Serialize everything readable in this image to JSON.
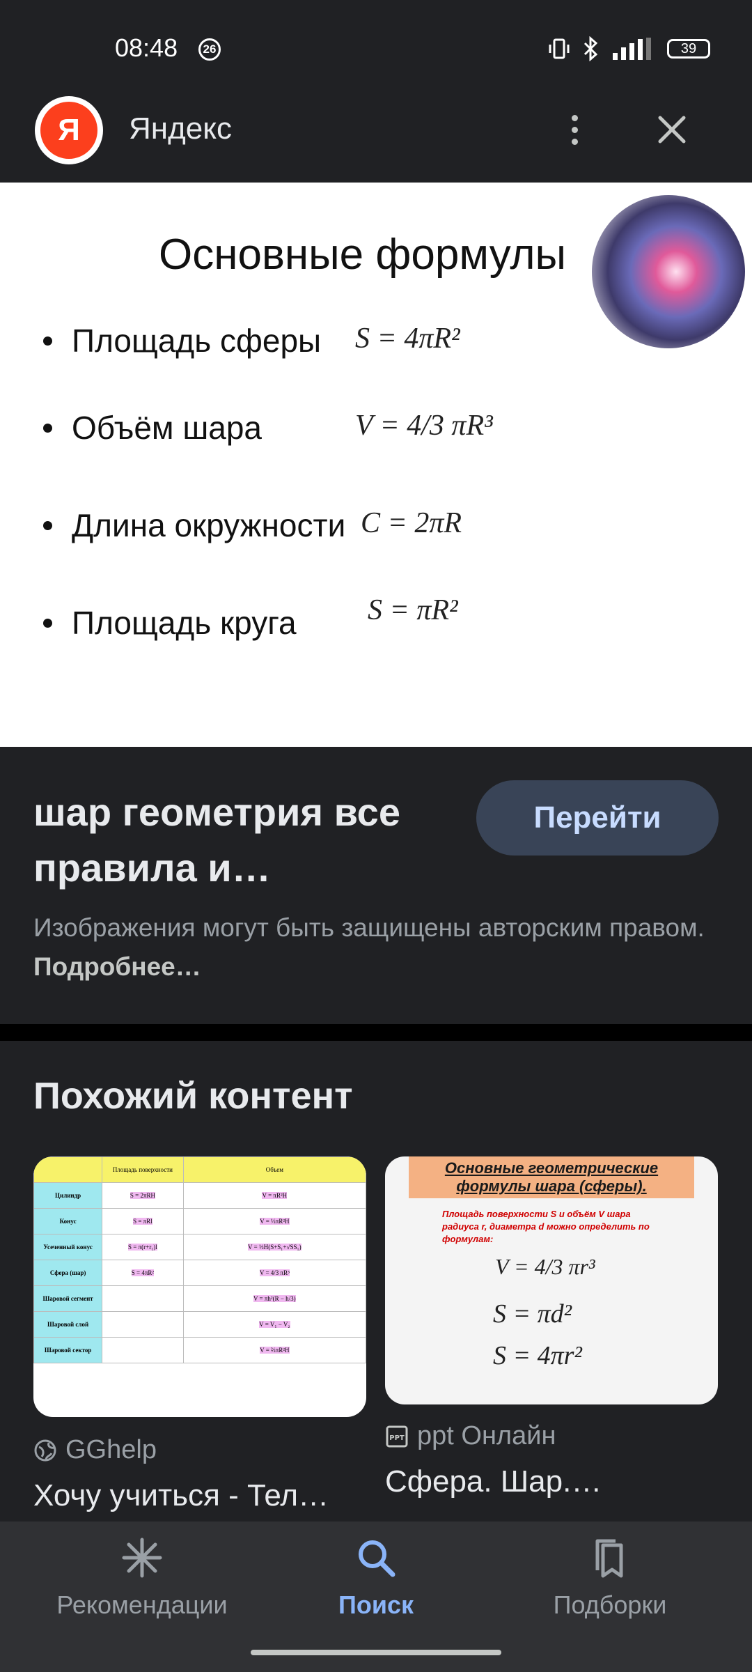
{
  "status_bar": {
    "time": "08:48",
    "notification_count": "26",
    "battery": "39"
  },
  "app_bar": {
    "logo_letter": "Я",
    "title": "Яндекс"
  },
  "image": {
    "title": "Основные формулы",
    "rows": [
      {
        "label": "Площадь сферы",
        "formula": "S = 4πR²"
      },
      {
        "label": "Объём шара",
        "formula": "V = 4/3 πR³"
      },
      {
        "label": "Длина окружности",
        "formula": "C = 2πR"
      },
      {
        "label": "Площадь круга",
        "formula": "S = πR²"
      }
    ]
  },
  "result": {
    "title": "шар геометрия все правила и…",
    "go_button": "Перейти",
    "copyright_text": "Изображения могут быть защищены авторским правом.",
    "copyright_link": "Подробнее…"
  },
  "similar": {
    "heading": "Похожий контент",
    "items": [
      {
        "source": "GGhelp",
        "caption": "Хочу учиться - Тел…",
        "table_headers": [
          "Площадь поверхности",
          "Объем"
        ],
        "table_rows": [
          "Цилиндр",
          "Конус",
          "Усеченный конус",
          "Сфера (шар)",
          "Шаровой сегмент",
          "Шаровой слой",
          "Шаровой сектор"
        ]
      },
      {
        "source": "ppt Онлайн",
        "caption": "Сфера. Шар.…",
        "banner": "Основные геометрические формулы шара (сферы).",
        "subtitle": "Площадь поверхности S и объём V шара радиуса r, диаметра d можно определить по формулам:",
        "formulas": [
          "V = 4/3 πr³",
          "S = πd²",
          "S = 4πr²"
        ]
      }
    ]
  },
  "bottom_nav": [
    {
      "label": "Рекомендации",
      "icon": "asterisk-icon"
    },
    {
      "label": "Поиск",
      "icon": "search-icon"
    },
    {
      "label": "Подборки",
      "icon": "collections-icon"
    }
  ]
}
